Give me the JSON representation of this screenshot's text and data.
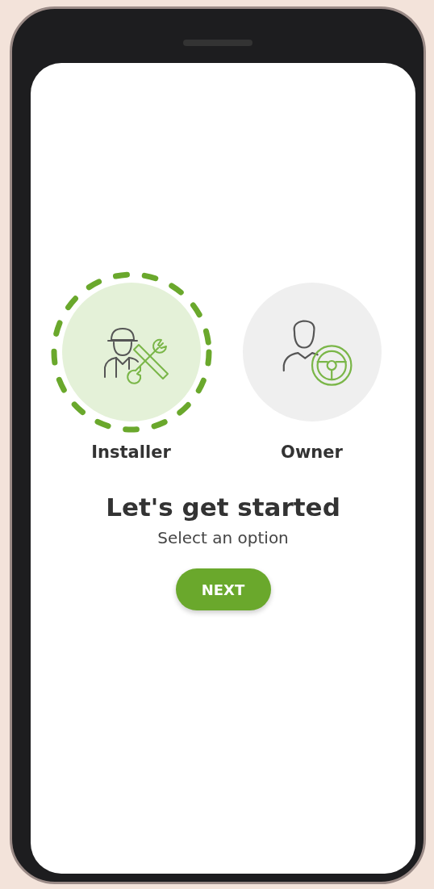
{
  "options": [
    {
      "label": "Installer",
      "kind": "installer",
      "selected": true
    },
    {
      "label": "Owner",
      "kind": "owner",
      "selected": false
    }
  ],
  "title": "Let's get started",
  "subtitle": "Select an option",
  "button": "NEXT"
}
